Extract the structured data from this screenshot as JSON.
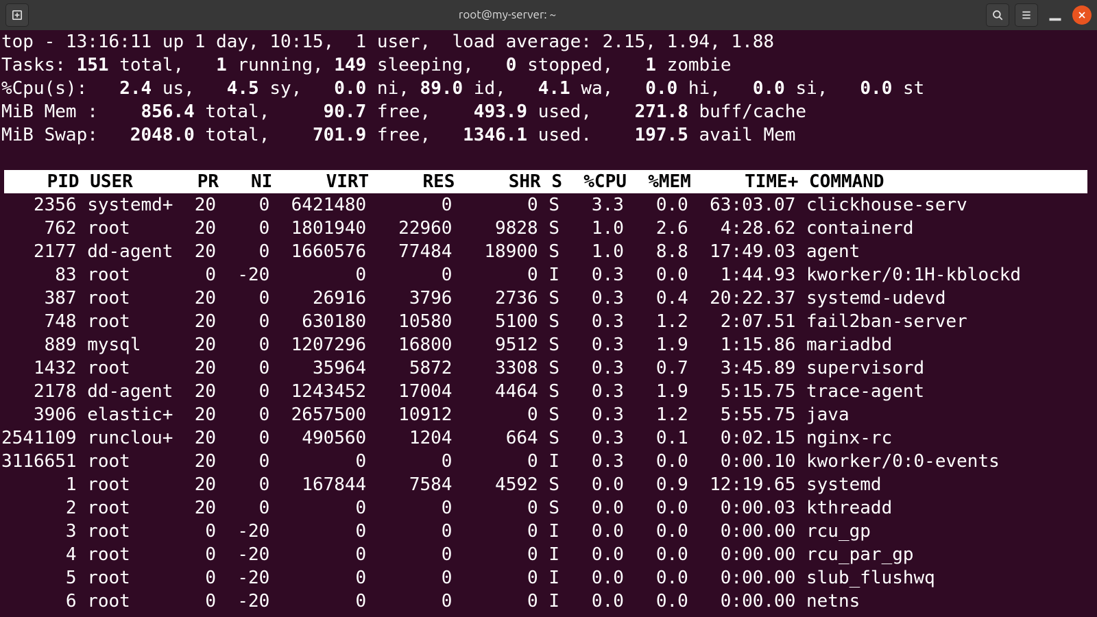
{
  "window": {
    "title": "root@my-server: ~"
  },
  "top": {
    "time": "13:16:11",
    "uptime": "1 day, 10:15",
    "users": "1",
    "load": [
      "2.15",
      "1.94",
      "1.88"
    ],
    "tasks": {
      "total": "151",
      "running": "1",
      "sleeping": "149",
      "stopped": "0",
      "zombie": "1"
    },
    "cpu": {
      "us": "2.4",
      "sy": "4.5",
      "ni": "0.0",
      "id": "89.0",
      "wa": "4.1",
      "hi": "0.0",
      "si": "0.0",
      "st": "0.0"
    },
    "mem": {
      "total": "856.4",
      "free": "90.7",
      "used": "493.9",
      "buff": "271.8"
    },
    "swap": {
      "total": "2048.0",
      "free": "701.9",
      "used": "1346.1",
      "avail": "197.5"
    },
    "columns": [
      "PID",
      "USER",
      "PR",
      "NI",
      "VIRT",
      "RES",
      "SHR",
      "S",
      "%CPU",
      "%MEM",
      "TIME+",
      "COMMAND"
    ],
    "processes": [
      {
        "pid": "2356",
        "user": "systemd+",
        "pr": "20",
        "ni": "0",
        "virt": "6421480",
        "res": "0",
        "shr": "0",
        "s": "S",
        "cpu": "3.3",
        "mem": "0.0",
        "time": "63:03.07",
        "cmd": "clickhouse-serv"
      },
      {
        "pid": "762",
        "user": "root",
        "pr": "20",
        "ni": "0",
        "virt": "1801940",
        "res": "22960",
        "shr": "9828",
        "s": "S",
        "cpu": "1.0",
        "mem": "2.6",
        "time": "4:28.62",
        "cmd": "containerd"
      },
      {
        "pid": "2177",
        "user": "dd-agent",
        "pr": "20",
        "ni": "0",
        "virt": "1660576",
        "res": "77484",
        "shr": "18900",
        "s": "S",
        "cpu": "1.0",
        "mem": "8.8",
        "time": "17:49.03",
        "cmd": "agent"
      },
      {
        "pid": "83",
        "user": "root",
        "pr": "0",
        "ni": "-20",
        "virt": "0",
        "res": "0",
        "shr": "0",
        "s": "I",
        "cpu": "0.3",
        "mem": "0.0",
        "time": "1:44.93",
        "cmd": "kworker/0:1H-kblockd"
      },
      {
        "pid": "387",
        "user": "root",
        "pr": "20",
        "ni": "0",
        "virt": "26916",
        "res": "3796",
        "shr": "2736",
        "s": "S",
        "cpu": "0.3",
        "mem": "0.4",
        "time": "20:22.37",
        "cmd": "systemd-udevd"
      },
      {
        "pid": "748",
        "user": "root",
        "pr": "20",
        "ni": "0",
        "virt": "630180",
        "res": "10580",
        "shr": "5100",
        "s": "S",
        "cpu": "0.3",
        "mem": "1.2",
        "time": "2:07.51",
        "cmd": "fail2ban-server"
      },
      {
        "pid": "889",
        "user": "mysql",
        "pr": "20",
        "ni": "0",
        "virt": "1207296",
        "res": "16800",
        "shr": "9512",
        "s": "S",
        "cpu": "0.3",
        "mem": "1.9",
        "time": "1:15.86",
        "cmd": "mariadbd"
      },
      {
        "pid": "1432",
        "user": "root",
        "pr": "20",
        "ni": "0",
        "virt": "35964",
        "res": "5872",
        "shr": "3308",
        "s": "S",
        "cpu": "0.3",
        "mem": "0.7",
        "time": "3:45.89",
        "cmd": "supervisord"
      },
      {
        "pid": "2178",
        "user": "dd-agent",
        "pr": "20",
        "ni": "0",
        "virt": "1243452",
        "res": "17004",
        "shr": "4464",
        "s": "S",
        "cpu": "0.3",
        "mem": "1.9",
        "time": "5:15.75",
        "cmd": "trace-agent"
      },
      {
        "pid": "3906",
        "user": "elastic+",
        "pr": "20",
        "ni": "0",
        "virt": "2657500",
        "res": "10912",
        "shr": "0",
        "s": "S",
        "cpu": "0.3",
        "mem": "1.2",
        "time": "5:55.75",
        "cmd": "java"
      },
      {
        "pid": "2541109",
        "user": "runclou+",
        "pr": "20",
        "ni": "0",
        "virt": "490560",
        "res": "1204",
        "shr": "664",
        "s": "S",
        "cpu": "0.3",
        "mem": "0.1",
        "time": "0:02.15",
        "cmd": "nginx-rc"
      },
      {
        "pid": "3116651",
        "user": "root",
        "pr": "20",
        "ni": "0",
        "virt": "0",
        "res": "0",
        "shr": "0",
        "s": "I",
        "cpu": "0.3",
        "mem": "0.0",
        "time": "0:00.10",
        "cmd": "kworker/0:0-events"
      },
      {
        "pid": "1",
        "user": "root",
        "pr": "20",
        "ni": "0",
        "virt": "167844",
        "res": "7584",
        "shr": "4592",
        "s": "S",
        "cpu": "0.0",
        "mem": "0.9",
        "time": "12:19.65",
        "cmd": "systemd"
      },
      {
        "pid": "2",
        "user": "root",
        "pr": "20",
        "ni": "0",
        "virt": "0",
        "res": "0",
        "shr": "0",
        "s": "S",
        "cpu": "0.0",
        "mem": "0.0",
        "time": "0:00.03",
        "cmd": "kthreadd"
      },
      {
        "pid": "3",
        "user": "root",
        "pr": "0",
        "ni": "-20",
        "virt": "0",
        "res": "0",
        "shr": "0",
        "s": "I",
        "cpu": "0.0",
        "mem": "0.0",
        "time": "0:00.00",
        "cmd": "rcu_gp"
      },
      {
        "pid": "4",
        "user": "root",
        "pr": "0",
        "ni": "-20",
        "virt": "0",
        "res": "0",
        "shr": "0",
        "s": "I",
        "cpu": "0.0",
        "mem": "0.0",
        "time": "0:00.00",
        "cmd": "rcu_par_gp"
      },
      {
        "pid": "5",
        "user": "root",
        "pr": "0",
        "ni": "-20",
        "virt": "0",
        "res": "0",
        "shr": "0",
        "s": "I",
        "cpu": "0.0",
        "mem": "0.0",
        "time": "0:00.00",
        "cmd": "slub_flushwq"
      },
      {
        "pid": "6",
        "user": "root",
        "pr": "0",
        "ni": "-20",
        "virt": "0",
        "res": "0",
        "shr": "0",
        "s": "I",
        "cpu": "0.0",
        "mem": "0.0",
        "time": "0:00.00",
        "cmd": "netns"
      }
    ]
  }
}
